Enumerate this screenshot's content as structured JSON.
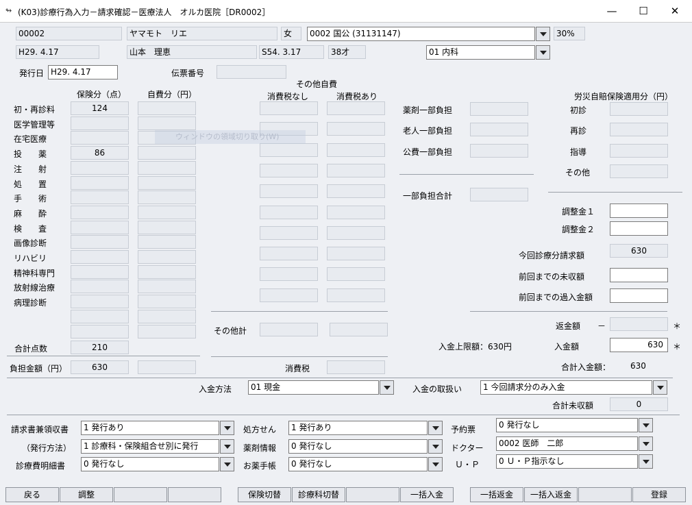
{
  "window": {
    "title": "(K03)診療行為入力－請求確認－医療法人　オルカ医院［DR0002］",
    "icon": "orca-app-icon",
    "minimize": "—",
    "maximize": "☐",
    "close": "✕"
  },
  "patient": {
    "id": "00002",
    "name": "ヤマモト　リエ",
    "sex": "女",
    "insurance": "0002 国公 (31131147)",
    "rate": "30%",
    "date": "H29. 4.17",
    "kanji_name": "山本　理恵",
    "birth": "S54. 3.17",
    "age": "38才",
    "dept": "01 内科"
  },
  "issue": {
    "date_label": "発行日",
    "date": "H29. 4.17",
    "slip_label": "伝票番号",
    "slip": ""
  },
  "headers": {
    "hoken": "保険分（点）",
    "jihi": "自費分（円）",
    "other_jihi": "その他自費",
    "tax_none": "消費税なし",
    "tax_incl": "消費税あり",
    "rosai": "労災自賠保険適用分（円）"
  },
  "rows": [
    {
      "label": "初・再診料",
      "hoken": "124",
      "jihi": ""
    },
    {
      "label": "医学管理等",
      "hoken": "",
      "jihi": ""
    },
    {
      "label": "在宅医療",
      "hoken": "",
      "jihi": ""
    },
    {
      "label": "投　　薬",
      "hoken": "86",
      "jihi": ""
    },
    {
      "label": "注　　射",
      "hoken": "",
      "jihi": ""
    },
    {
      "label": "処　　置",
      "hoken": "",
      "jihi": ""
    },
    {
      "label": "手　　術",
      "hoken": "",
      "jihi": ""
    },
    {
      "label": "麻　　酔",
      "hoken": "",
      "jihi": ""
    },
    {
      "label": "検　　査",
      "hoken": "",
      "jihi": ""
    },
    {
      "label": "画像診断",
      "hoken": "",
      "jihi": ""
    },
    {
      "label": "リハビリ",
      "hoken": "",
      "jihi": ""
    },
    {
      "label": "精神科専門",
      "hoken": "",
      "jihi": ""
    },
    {
      "label": "放射線治療",
      "hoken": "",
      "jihi": ""
    },
    {
      "label": "病理診断",
      "hoken": "",
      "jihi": ""
    },
    {
      "label": "",
      "hoken": "",
      "jihi": ""
    },
    {
      "label": "",
      "hoken": "",
      "jihi": ""
    }
  ],
  "totals": {
    "points_label": "合計点数",
    "points": "210",
    "burden_label": "負担金額（円）",
    "burden": "630",
    "burden_jihi": "",
    "other_total_label": "その他計",
    "tax_label": "消費税"
  },
  "partial": {
    "drug": "薬剤一部負担",
    "elder": "老人一部負担",
    "public": "公費一部負担",
    "total": "一部負担合計"
  },
  "rosai_rows": [
    "初診",
    "再診",
    "指導",
    "その他"
  ],
  "adjust": {
    "adj1": "調整金１",
    "adj2": "調整金２",
    "claim_label": "今回診療分請求額",
    "claim": "630",
    "unpaid_label": "前回までの未収額",
    "over_label": "前回までの過入金額",
    "refund_label": "返金額",
    "refund_dash": "－",
    "deposit_label": "入金額",
    "deposit": "630",
    "limit_label": "入金上限額：630円",
    "total_label": "合計入金額：",
    "total": "630",
    "star": "＊"
  },
  "payment": {
    "method_label": "入金方法",
    "method": "01 現金",
    "handling_label": "入金の取扱い",
    "handling": "1 今回請求分のみ入金",
    "total_unpaid_label": "合計未収額",
    "total_unpaid": "0"
  },
  "print": {
    "receipt_label": "請求書兼領収書",
    "receipt": "1 発行あり",
    "method_label": "（発行方法）",
    "method": "1 診療科・保険組合せ別に発行",
    "detail_label": "診療費明細書",
    "detail": "0 発行なし",
    "rx_label": "処方せん",
    "rx": "1 発行あり",
    "druginfo_label": "薬剤情報",
    "druginfo": "0 発行なし",
    "notebook_label": "お薬手帳",
    "notebook": "0 発行なし",
    "appt_label": "予約票",
    "appt": "0 発行なし",
    "doctor_label": "ドクター",
    "doctor": "0002 医師　二郎",
    "up_label": "Ｕ・Ｐ",
    "up": "0 Ｕ・Ｐ指示なし"
  },
  "ghost_text": "ウィンドウの領域切り取り(W)",
  "buttons": [
    "戻る",
    "調整",
    "",
    "",
    "保険切替",
    "診療科切替",
    "",
    "一括入金",
    "一括返金",
    "一括入返金",
    "",
    "登録"
  ]
}
